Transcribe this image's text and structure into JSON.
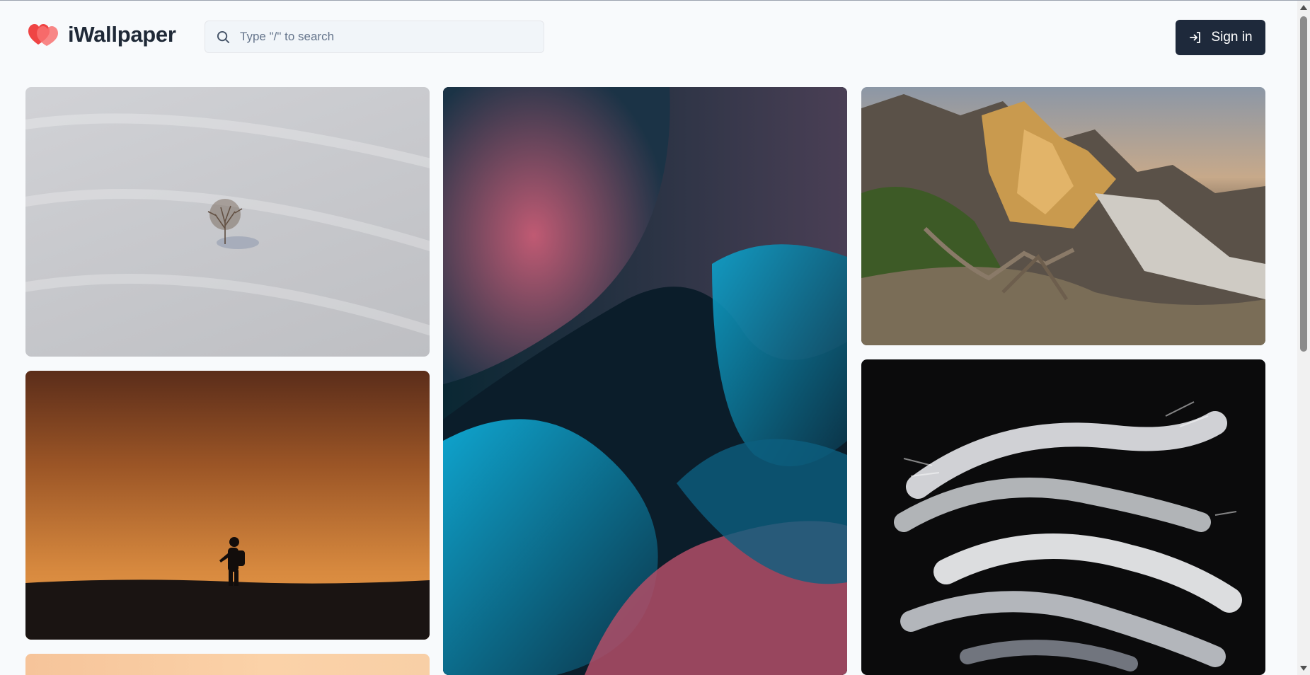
{
  "header": {
    "brand": "iWallpaper",
    "search_placeholder": "Type \"/\" to search",
    "sign_in_label": "Sign in"
  },
  "icons": {
    "logo": "hearts-logo-icon",
    "search": "search-icon",
    "sign_in": "sign-in-arrow-icon"
  },
  "colors": {
    "brand_red": "#ef4444",
    "button_bg": "#1e293b",
    "page_bg": "#f8fafc"
  },
  "gallery": {
    "tiles": [
      {
        "subject": "lone tree on snowy slope"
      },
      {
        "subject": "abstract teal and pink waves"
      },
      {
        "subject": "mountain ridge at sunset"
      },
      {
        "subject": "hiker silhouette at dusk"
      },
      {
        "subject": "white brush strokes on black"
      },
      {
        "subject": "peach gradient"
      }
    ]
  }
}
